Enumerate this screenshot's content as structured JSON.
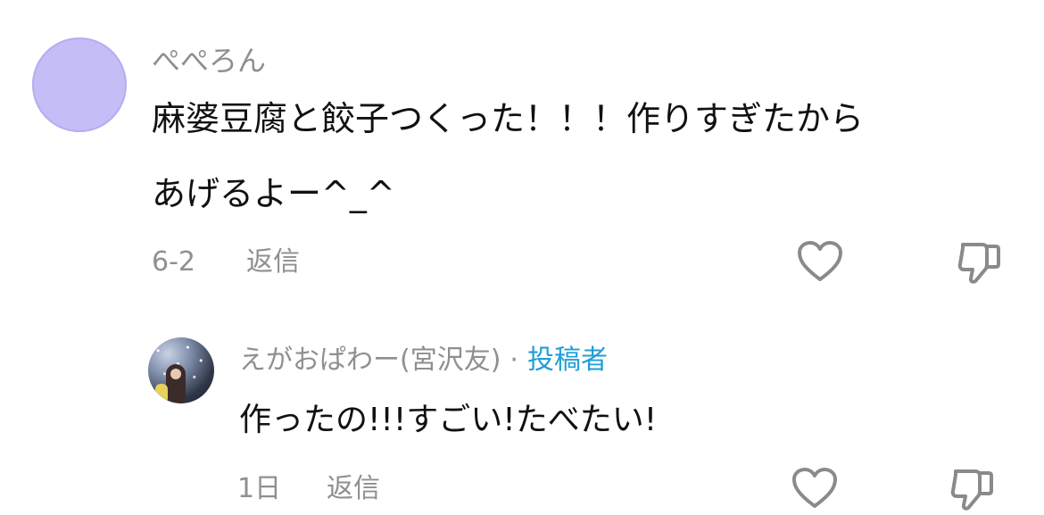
{
  "comments": [
    {
      "author": "ぺぺろん",
      "text_line1": "麻婆豆腐と餃子つくった！！！作りすぎたから",
      "text_line2": "あげるよー^_^",
      "time": "6-2",
      "reply_label": "返信",
      "avatar_color": "#c4bdf6",
      "like_icon": "heart-icon",
      "dislike_icon": "thumbs-down-icon"
    }
  ],
  "replies": [
    {
      "author": "えがおぱわー(宮沢友)",
      "separator": "·",
      "creator_badge": "投稿者",
      "text": "作ったの!!!すごい!たべたい!",
      "time": "1日",
      "reply_label": "返信",
      "badge_color": "#1f9ed7",
      "like_icon": "heart-icon",
      "dislike_icon": "thumbs-down-icon"
    }
  ]
}
